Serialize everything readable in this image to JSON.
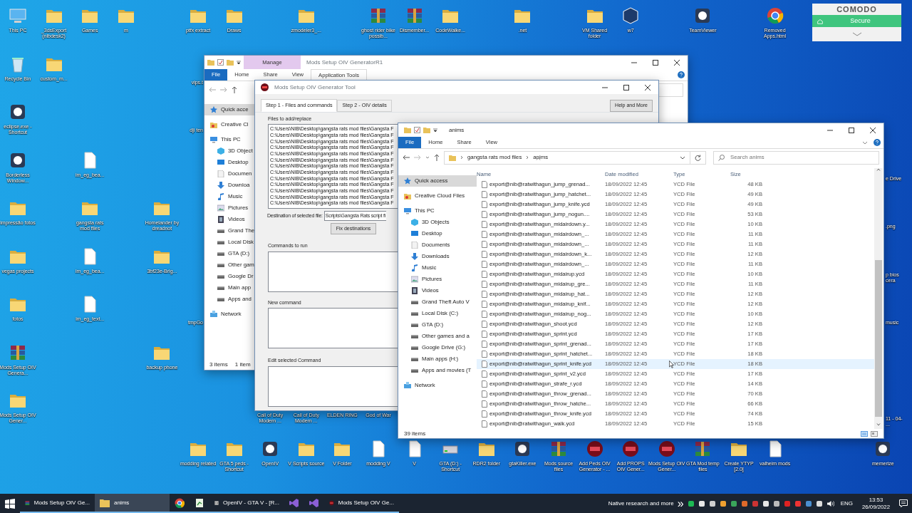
{
  "desktop_icons": [
    {
      "label": "This PC",
      "kind": "computer"
    },
    {
      "label": "_3dsExport (nibdesk2)",
      "kind": "folder"
    },
    {
      "label": "Games",
      "kind": "folder"
    },
    {
      "label": "m",
      "kind": "folder"
    },
    {
      "label": "ptfx extract",
      "kind": "folder"
    },
    {
      "label": "Draws",
      "kind": "folder"
    },
    {
      "label": "zmodeler3_...",
      "kind": "folder"
    },
    {
      "label": "ghost rider bike possib...",
      "kind": "archive"
    },
    {
      "label": "Dismember...",
      "kind": "archive"
    },
    {
      "label": "CodeWalke...",
      "kind": "folder"
    },
    {
      "label": ".net",
      "kind": "folder"
    },
    {
      "label": "VM Shared folder",
      "kind": "folder"
    },
    {
      "label": "w7",
      "kind": "cube"
    },
    {
      "label": "TeamViewer",
      "kind": "app"
    },
    {
      "label": "Removed Apps.html",
      "kind": "browser"
    },
    {
      "label": "Recycle Bin",
      "kind": "recycle"
    },
    {
      "label": "custom_m...",
      "kind": "folder"
    },
    {
      "label": "vips.t",
      "kind": "cut_left"
    },
    {
      "label": "eclipse.exe - Shortcut",
      "kind": "app"
    },
    {
      "label": "dji ten",
      "kind": "cut_left"
    },
    {
      "label": "Borderless Window...",
      "kind": "app"
    },
    {
      "label": "im_eg_bea...",
      "kind": "file"
    },
    {
      "label": "e Drive",
      "kind": "cut_right"
    },
    {
      "label": "impressão fotos",
      "kind": "folder"
    },
    {
      "label": "gangsta rats mod files",
      "kind": "folder"
    },
    {
      "label": "Homelander by dreadnot",
      "kind": "folder"
    },
    {
      "label": ".png",
      "kind": "cut_right"
    },
    {
      "label": "vegas projects",
      "kind": "folder"
    },
    {
      "label": "im_eg_bea...",
      "kind": "file"
    },
    {
      "label": "3bf23e-Brig...",
      "kind": "folder"
    },
    {
      "label": "p bios cera",
      "kind": "cut_right"
    },
    {
      "label": "fotos",
      "kind": "folder"
    },
    {
      "label": "im_eg_text...",
      "kind": "file"
    },
    {
      "label": "tmpGo",
      "kind": "cut_left"
    },
    {
      "label": "music",
      "kind": "cut_right"
    },
    {
      "label": "Mods Setup OIV Genera...",
      "kind": "archive"
    },
    {
      "label": "backup phone",
      "kind": "folder"
    },
    {
      "label": "Mods Setup OIV Gener...",
      "kind": "folder"
    },
    {
      "label": "Call of Duty Modern ...",
      "kind": "hidden"
    },
    {
      "label": "Call of Duty Modern ...",
      "kind": "hidden"
    },
    {
      "label": "ELDEN RING",
      "kind": "hidden"
    },
    {
      "label": "God of War",
      "kind": "hidden"
    },
    {
      "label": "11 - 04- ...",
      "kind": "cut_right"
    },
    {
      "label": "modding related",
      "kind": "folder"
    },
    {
      "label": "GTA 5 peds - Shortcut",
      "kind": "folder"
    },
    {
      "label": "OpenIV",
      "kind": "app"
    },
    {
      "label": "V Scripts source",
      "kind": "folder"
    },
    {
      "label": "V Folder",
      "kind": "folder"
    },
    {
      "label": "modding V",
      "kind": "file"
    },
    {
      "label": "V",
      "kind": "file"
    },
    {
      "label": "GTA (D:) - Shortcut",
      "kind": "drive"
    },
    {
      "label": "RDR2 folder",
      "kind": "folder"
    },
    {
      "label": "gtaKiller.exe",
      "kind": "app"
    },
    {
      "label": "Mods source files",
      "kind": "archive"
    },
    {
      "label": "Add Peds OIV Generator - ...",
      "kind": "redapp"
    },
    {
      "label": "Add PROPS OIV Gener...",
      "kind": "redapp"
    },
    {
      "label": "Mods Setup OIV Gener...",
      "kind": "redapp"
    },
    {
      "label": "GTA Mod temp files",
      "kind": "archive"
    },
    {
      "label": "Create YTYP [2.0]",
      "kind": "folder"
    },
    {
      "label": "valheim mods",
      "kind": "file"
    },
    {
      "label": "memerize",
      "kind": "app"
    }
  ],
  "comodo": {
    "title": "COMODO",
    "status": "Secure"
  },
  "back_explorer": {
    "context_tab": "Manage",
    "title": "Mods Setup OIV GeneratorR1",
    "tabs": [
      {
        "label": "File",
        "selected": true
      },
      {
        "label": "Home",
        "selected": false
      },
      {
        "label": "Share",
        "selected": false
      },
      {
        "label": "View",
        "selected": false
      },
      {
        "label": "Application Tools",
        "selected": false
      }
    ],
    "nav": [
      {
        "label": "Quick acce",
        "kind": "star",
        "selected": true
      },
      {
        "label": "Creative Cl",
        "kind": "cloud",
        "selected": false
      },
      {
        "label": "This PC",
        "kind": "pc",
        "selected": false,
        "children": [
          {
            "label": "3D Object",
            "kind": "cube",
            "selected": false
          },
          {
            "label": "Desktop",
            "kind": "desktop",
            "selected": false
          },
          {
            "label": "Documen",
            "kind": "docs",
            "selected": false
          },
          {
            "label": "Downloa",
            "kind": "download",
            "selected": false
          },
          {
            "label": "Music",
            "kind": "music",
            "selected": false
          },
          {
            "label": "Pictures",
            "kind": "pictures",
            "selected": false
          },
          {
            "label": "Videos",
            "kind": "videos",
            "selected": false
          },
          {
            "label": "Grand The",
            "kind": "drive",
            "selected": false
          },
          {
            "label": "Local Disk",
            "kind": "drive",
            "selected": false
          },
          {
            "label": "GTA (D:)",
            "kind": "drive",
            "selected": false
          },
          {
            "label": "Other gam",
            "kind": "drive",
            "selected": false
          },
          {
            "label": "Google Dr",
            "kind": "drive",
            "selected": false
          },
          {
            "label": "Main app",
            "kind": "drive",
            "selected": false
          },
          {
            "label": "Apps and",
            "kind": "drive",
            "selected": false
          }
        ]
      },
      {
        "label": "Network",
        "kind": "network",
        "selected": false
      }
    ],
    "status": [
      "3 items",
      "1 item"
    ]
  },
  "oiv_tool": {
    "title": "Mods Setup OIV Generator Tool",
    "tabs": [
      {
        "label": "Step 1 - Files and commands",
        "selected": true
      },
      {
        "label": "Step 2 - OIV details",
        "selected": false
      }
    ],
    "help_button": "Help and More",
    "files_label": "Files to add/replace",
    "files": [
      "C:\\Users\\NIB\\Desktop\\gangsta rats mod files\\Gangsta F",
      "C:\\Users\\NIB\\Desktop\\gangsta rats mod files\\Gangsta F",
      "C:\\Users\\NIB\\Desktop\\gangsta rats mod files\\Gangsta F",
      "C:\\Users\\NIB\\Desktop\\gangsta rats mod files\\Gangsta F",
      "C:\\Users\\NIB\\Desktop\\gangsta rats mod files\\Gangsta F",
      "C:\\Users\\NIB\\Desktop\\gangsta rats mod files\\Gangsta F",
      "C:\\Users\\NIB\\Desktop\\gangsta rats mod files\\Gangsta F",
      "C:\\Users\\NIB\\Desktop\\gangsta rats mod files\\Gangsta F",
      "C:\\Users\\NIB\\Desktop\\gangsta rats mod files\\Gangsta F",
      "C:\\Users\\NIB\\Desktop\\gangsta rats mod files\\Gangsta F",
      "C:\\Users\\NIB\\Desktop\\gangsta rats mod files\\Gangsta F",
      "C:\\Users\\NIB\\Desktop\\gangsta rats mod files\\Gangsta F",
      "C:\\Users\\NIB\\Desktop\\gangsta rats mod files\\Gangsta F"
    ],
    "destination_label": "Destination of selected file:",
    "destination_value": "Scripts\\Gangsta Rats script fi",
    "fix_button": "Fix destinations",
    "commands_label": "Commands to run",
    "new_command_label": "New command",
    "edit_command_label": "Edit selected Command"
  },
  "explorer": {
    "title": "anims",
    "tabs": [
      {
        "label": "File",
        "selected": true
      },
      {
        "label": "Home",
        "selected": false
      },
      {
        "label": "Share",
        "selected": false
      },
      {
        "label": "View",
        "selected": false
      }
    ],
    "breadcrumb": [
      "gangsta rats mod files",
      "anims"
    ],
    "search": {
      "placeholder": "Search anims"
    },
    "nav": [
      {
        "label": "Quick access",
        "kind": "star",
        "selected": true
      },
      {
        "label": "Creative Cloud Files",
        "kind": "cloud",
        "selected": false
      },
      {
        "label": "This PC",
        "kind": "pc",
        "selected": false,
        "children": [
          {
            "label": "3D Objects",
            "kind": "cube",
            "selected": false
          },
          {
            "label": "Desktop",
            "kind": "desktop",
            "selected": false
          },
          {
            "label": "Documents",
            "kind": "docs",
            "selected": false
          },
          {
            "label": "Downloads",
            "kind": "download",
            "selected": false
          },
          {
            "label": "Music",
            "kind": "music",
            "selected": false
          },
          {
            "label": "Pictures",
            "kind": "pictures",
            "selected": false
          },
          {
            "label": "Videos",
            "kind": "videos",
            "selected": false
          },
          {
            "label": "Grand Theft Auto V",
            "kind": "drive",
            "selected": false
          },
          {
            "label": "Local Disk (C:)",
            "kind": "drive",
            "selected": false
          },
          {
            "label": "GTA (D:)",
            "kind": "drive",
            "selected": false
          },
          {
            "label": "Other games and a",
            "kind": "drive",
            "selected": false
          },
          {
            "label": "Google Drive (G:)",
            "kind": "drive",
            "selected": false
          },
          {
            "label": "Main apps (H:)",
            "kind": "drive",
            "selected": false
          },
          {
            "label": "Apps and movies (T",
            "kind": "drive",
            "selected": false
          }
        ]
      },
      {
        "label": "Network",
        "kind": "network",
        "selected": false
      }
    ],
    "columns": [
      "Name",
      "Date modified",
      "Type",
      "Size"
    ],
    "rows": [
      {
        "name": "export@nib@ratwithagun_jump_grenad...",
        "date": "18/09/2022 12:45",
        "type": "YCD File",
        "size": "48 KB",
        "selected": false
      },
      {
        "name": "export@nib@ratwithagun_jump_hatchet...",
        "date": "18/09/2022 12:45",
        "type": "YCD File",
        "size": "49 KB",
        "selected": false
      },
      {
        "name": "export@nib@ratwithagun_jump_knife.ycd",
        "date": "18/09/2022 12:45",
        "type": "YCD File",
        "size": "49 KB",
        "selected": false
      },
      {
        "name": "export@nib@ratwithagun_jump_nogun....",
        "date": "18/09/2022 12:45",
        "type": "YCD File",
        "size": "53 KB",
        "selected": false
      },
      {
        "name": "export@nib@ratwithagun_midairdown.y...",
        "date": "18/09/2022 12:45",
        "type": "YCD File",
        "size": "10 KB",
        "selected": false
      },
      {
        "name": "export@nib@ratwithagun_midairdown_...",
        "date": "18/09/2022 12:45",
        "type": "YCD File",
        "size": "11 KB",
        "selected": false
      },
      {
        "name": "export@nib@ratwithagun_midairdown_...",
        "date": "18/09/2022 12:45",
        "type": "YCD File",
        "size": "11 KB",
        "selected": false
      },
      {
        "name": "export@nib@ratwithagun_midairdown_k...",
        "date": "18/09/2022 12:45",
        "type": "YCD File",
        "size": "12 KB",
        "selected": false
      },
      {
        "name": "export@nib@ratwithagun_midairdown_...",
        "date": "18/09/2022 12:45",
        "type": "YCD File",
        "size": "11 KB",
        "selected": false
      },
      {
        "name": "export@nib@ratwithagun_midairup.ycd",
        "date": "18/09/2022 12:45",
        "type": "YCD File",
        "size": "10 KB",
        "selected": false
      },
      {
        "name": "export@nib@ratwithagun_midairup_gre...",
        "date": "18/09/2022 12:45",
        "type": "YCD File",
        "size": "11 KB",
        "selected": false
      },
      {
        "name": "export@nib@ratwithagun_midairup_hat...",
        "date": "18/09/2022 12:45",
        "type": "YCD File",
        "size": "12 KB",
        "selected": false
      },
      {
        "name": "export@nib@ratwithagun_midairup_knif...",
        "date": "18/09/2022 12:45",
        "type": "YCD File",
        "size": "12 KB",
        "selected": false
      },
      {
        "name": "export@nib@ratwithagun_midairup_nog...",
        "date": "18/09/2022 12:45",
        "type": "YCD File",
        "size": "10 KB",
        "selected": false
      },
      {
        "name": "export@nib@ratwithagun_shoot.ycd",
        "date": "18/09/2022 12:45",
        "type": "YCD File",
        "size": "12 KB",
        "selected": false
      },
      {
        "name": "export@nib@ratwithagun_sprint.ycd",
        "date": "18/09/2022 12:45",
        "type": "YCD File",
        "size": "17 KB",
        "selected": false
      },
      {
        "name": "export@nib@ratwithagun_sprint_grenad...",
        "date": "18/09/2022 12:45",
        "type": "YCD File",
        "size": "17 KB",
        "selected": false
      },
      {
        "name": "export@nib@ratwithagun_sprint_hatchet...",
        "date": "18/09/2022 12:45",
        "type": "YCD File",
        "size": "18 KB",
        "selected": false
      },
      {
        "name": "export@nib@ratwithagun_sprint_knife.ycd",
        "date": "18/09/2022 12:45",
        "type": "YCD File",
        "size": "18 KB",
        "selected": true
      },
      {
        "name": "export@nib@ratwithagun_sprint_v2.ycd",
        "date": "18/09/2022 12:45",
        "type": "YCD File",
        "size": "17 KB",
        "selected": false
      },
      {
        "name": "export@nib@ratwithagun_strafe_r.ycd",
        "date": "18/09/2022 12:45",
        "type": "YCD File",
        "size": "14 KB",
        "selected": false
      },
      {
        "name": "export@nib@ratwithagun_throw_grenad...",
        "date": "18/09/2022 12:45",
        "type": "YCD File",
        "size": "70 KB",
        "selected": false
      },
      {
        "name": "export@nib@ratwithagun_throw_hatche...",
        "date": "18/09/2022 12:45",
        "type": "YCD File",
        "size": "66 KB",
        "selected": false
      },
      {
        "name": "export@nib@ratwithagun_throw_knife.ycd",
        "date": "18/09/2022 12:45",
        "type": "YCD File",
        "size": "74 KB",
        "selected": false
      },
      {
        "name": "export@nib@ratwithagun_walk.ycd",
        "date": "18/09/2022 12:45",
        "type": "YCD File",
        "size": "15 KB",
        "selected": false
      }
    ],
    "status": "39 items"
  },
  "taskbar": {
    "items": [
      {
        "label": "Mods Setup OIV Ge...",
        "kind": "archive",
        "selected": false
      },
      {
        "label": "anims",
        "kind": "folder",
        "selected": true
      },
      {
        "kind": "browser",
        "selected": false
      },
      {
        "kind": "sheet",
        "selected": false
      },
      {
        "label": "OpenIV - GTA V - [R...",
        "kind": "openiv",
        "selected": false
      },
      {
        "kind": "vs",
        "selected": false
      },
      {
        "kind": "vs",
        "selected": false
      },
      {
        "label": "Mods Setup OIV Ge...",
        "kind": "redapp",
        "selected": false
      }
    ],
    "tray_label": "Native research and more",
    "overflow": "»",
    "language": "ENG",
    "time": "13:53",
    "date": "26/09/2022"
  }
}
